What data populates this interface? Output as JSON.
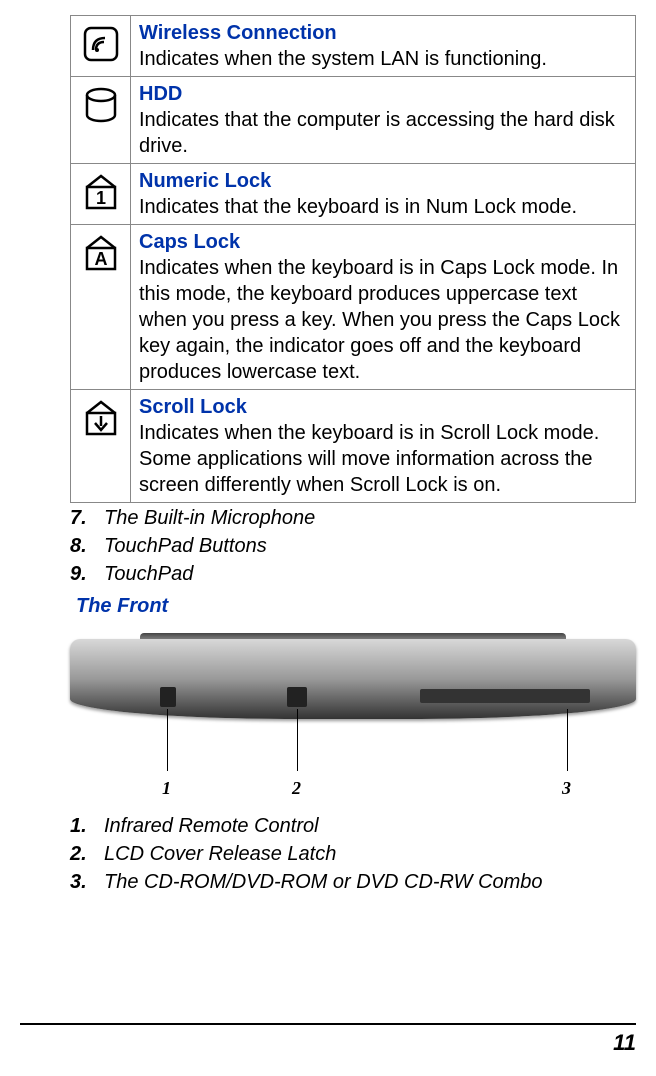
{
  "indicators": [
    {
      "title": "Wireless Connection",
      "description": "Indicates when the system LAN is functioning."
    },
    {
      "title": "HDD",
      "description": "Indicates that the computer is accessing the hard disk drive."
    },
    {
      "title": "Numeric Lock",
      "description": "Indicates that the keyboard is in Num Lock mode."
    },
    {
      "title": "Caps Lock",
      "description": "Indicates when the keyboard is in Caps Lock mode.  In this mode, the keyboard produces uppercase text when you press a key.  When you press the Caps Lock key again, the indicator goes off and the keyboard produces lowercase text."
    },
    {
      "title": "Scroll Lock",
      "description": "Indicates when the keyboard is in Scroll Lock mode.  Some applications will move information across the screen differently when Scroll Lock is on."
    }
  ],
  "top_numbered": [
    {
      "n": "7.",
      "label": "The Built-in Microphone"
    },
    {
      "n": "8.",
      "label": "TouchPad Buttons"
    },
    {
      "n": "9.",
      "label": "TouchPad"
    }
  ],
  "section_front": "The Front",
  "figure_callouts": {
    "c1": "1",
    "c2": "2",
    "c3": "3"
  },
  "bottom_numbered": [
    {
      "n": "1.",
      "label": "Infrared Remote Control"
    },
    {
      "n": "2.",
      "label": "LCD Cover Release Latch"
    },
    {
      "n": "3.",
      "label": "The CD-ROM/DVD-ROM or DVD CD-RW Combo"
    }
  ],
  "page_number": "11"
}
